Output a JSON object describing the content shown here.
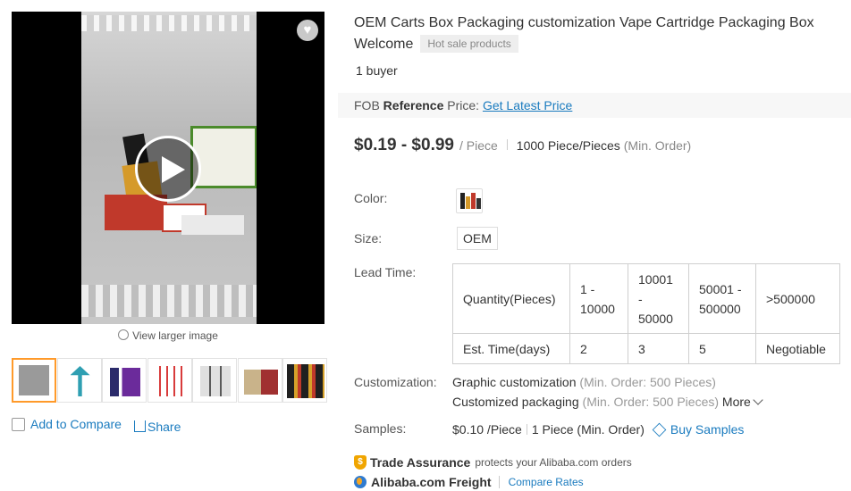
{
  "media": {
    "view_larger_label": "View larger image",
    "thumbnails": [
      "thumb-1",
      "thumb-2",
      "thumb-3",
      "thumb-4",
      "thumb-5",
      "thumb-6",
      "thumb-7"
    ]
  },
  "actions": {
    "add_to_compare": "Add to Compare",
    "share": "Share"
  },
  "product": {
    "title": "OEM Carts Box Packaging customization Vape Cartridge Packaging Box Welcome",
    "hot_badge": "Hot sale products",
    "buyers": "1 buyer",
    "fob_prefix": "FOB ",
    "fob_bold": "Reference",
    "fob_suffix": " Price:",
    "fob_link": "Get Latest Price",
    "price": "$0.19 - $0.99",
    "price_unit": "/ Piece",
    "moq_value": "1000 Piece/Pieces",
    "moq_note": "(Min. Order)"
  },
  "attributes": {
    "color_label": "Color:",
    "size_label": "Size:",
    "size_value": "OEM",
    "lead_time_label": "Lead Time:",
    "customization_label": "Customization:",
    "samples_label": "Samples:"
  },
  "lead_time_table": {
    "row1": [
      "Quantity(Pieces)",
      "1 - 10000",
      "10001 - 50000",
      "50001 - 500000",
      ">500000"
    ],
    "row2": [
      "Est. Time(days)",
      "2",
      "3",
      "5",
      "Negotiable"
    ]
  },
  "customization": {
    "line1": "Graphic customization",
    "line1_note": "(Min. Order: 500 Pieces)",
    "line2": "Customized packaging",
    "line2_note": "(Min. Order: 500 Pieces)",
    "more": "More"
  },
  "samples": {
    "price": "$0.10 /Piece",
    "qty": "1 Piece (Min. Order)",
    "buy": "Buy Samples"
  },
  "assurance": {
    "trade_title": "Trade Assurance",
    "trade_text": "protects your Alibaba.com orders",
    "freight_title": "Alibaba.com Freight",
    "compare_rates": "Compare Rates"
  }
}
